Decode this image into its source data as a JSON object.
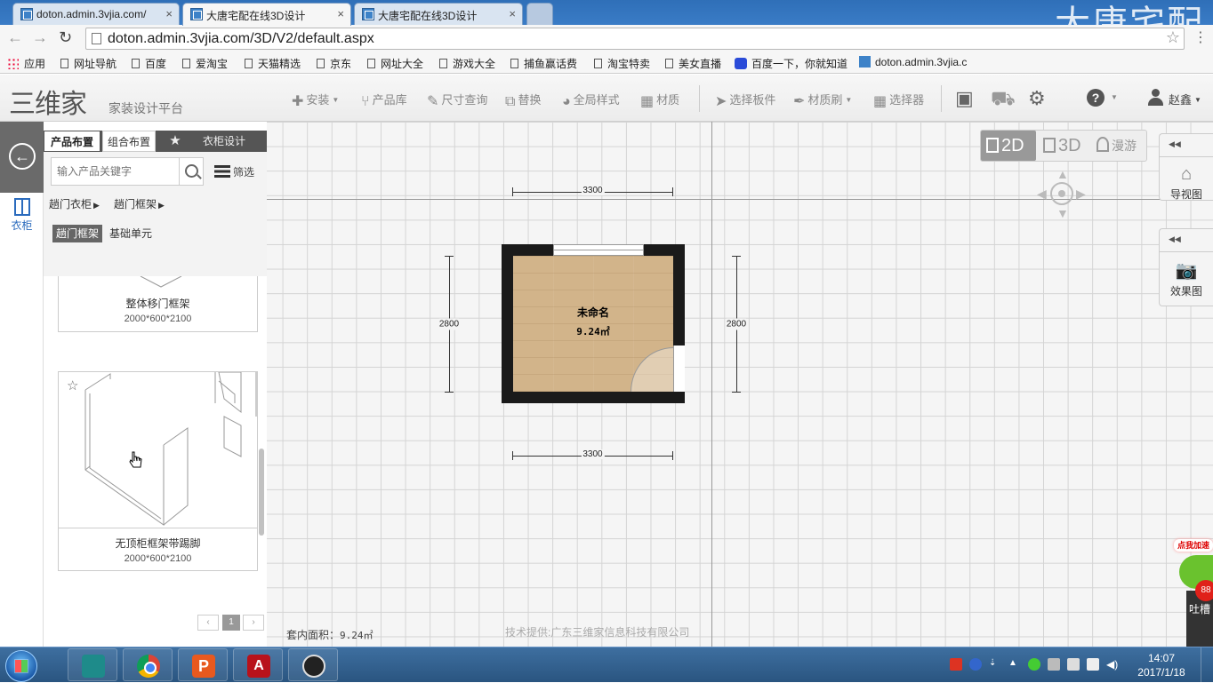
{
  "browser": {
    "tabs": [
      {
        "title": "doton.admin.3vjia.com/",
        "active": false
      },
      {
        "title": "大唐宅配在线3D设计",
        "active": true
      },
      {
        "title": "大唐宅配在线3D设计",
        "active": false
      }
    ],
    "watermark": "大唐宅配",
    "url": "doton.admin.3vjia.com/3D/V2/default.aspx",
    "bookmarks": [
      "应用",
      "网址导航",
      "百度",
      "爱淘宝",
      "天猫精选",
      "京东",
      "网址大全",
      "游戏大全",
      "捕鱼赢话费",
      "淘宝特卖",
      "美女直播",
      "百度一下，你就知道",
      "doton.admin.3vjia.c"
    ]
  },
  "app": {
    "logo": "三维家",
    "logo_subtitle": "家装设计平台",
    "toolbar": {
      "install": "安装",
      "product_library": "产品库",
      "size_query": "尺寸查询",
      "replace": "替换",
      "global_style": "全局样式",
      "material": "材质",
      "select_board": "选择板件",
      "material_brush": "材质刷",
      "selector": "选择器",
      "user": "赵鑫"
    },
    "icons": {
      "save": "save-icon",
      "cart": "cart-icon",
      "settings": "gear-icon",
      "help": "help-icon",
      "user": "user-icon"
    }
  },
  "sidebar": {
    "category_label": "衣柜",
    "tabs": [
      "产品布置",
      "组合布置",
      "衣柜设计"
    ],
    "search_placeholder": "输入产品关键字",
    "filter_label": "筛选",
    "breadcrumbs": [
      "趟门衣柜",
      "趟门框架"
    ],
    "chips": [
      {
        "label": "趟门框架",
        "active": true
      },
      {
        "label": "基础单元",
        "active": false
      }
    ],
    "products": [
      {
        "name": "整体移门框架",
        "dims": "2000*600*2100"
      },
      {
        "name": "无顶柜框架带踢脚",
        "dims": "2000*600*2100"
      }
    ],
    "pager": {
      "prev": "‹",
      "current": "1",
      "next": "›"
    }
  },
  "canvas": {
    "view_modes": [
      "2D",
      "3D",
      "漫游"
    ],
    "active_view": "2D",
    "dimensions": {
      "top": "3300",
      "bottom": "3300",
      "left": "2800",
      "right": "2800"
    },
    "room": {
      "name": "未命名",
      "area": "9.24㎡"
    },
    "panels": {
      "nav_view": "导视图",
      "render_view": "效果图"
    },
    "footer_area_label": "套内面积：",
    "footer_area_value": "9.24㎡",
    "credit": "技术提供:广东三维家信息科技有限公司",
    "speed_widget": {
      "badge": "点我加速",
      "number": "88",
      "side_text": "吐槽"
    }
  },
  "taskbar": {
    "apps": [
      "3ds Max",
      "Google Chrome",
      "PowerPoint",
      "AutoCAD",
      "OBS"
    ],
    "time": "14:07",
    "date": "2017/1/18"
  }
}
